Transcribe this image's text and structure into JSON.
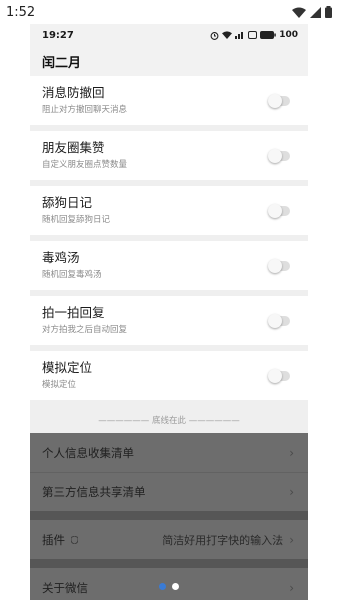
{
  "system_bar": {
    "time": "1:52"
  },
  "inner_status": {
    "time": "19:27",
    "battery": "100"
  },
  "header": {
    "title": "闰二月"
  },
  "settings": [
    {
      "title": "消息防撤回",
      "desc": "阻止对方撤回聊天消息"
    },
    {
      "title": "朋友圈集赞",
      "desc": "自定义朋友圈点赞数量"
    },
    {
      "title": "舔狗日记",
      "desc": "随机回复舔狗日记"
    },
    {
      "title": "毒鸡汤",
      "desc": "随机回复毒鸡汤"
    },
    {
      "title": "拍一拍回复",
      "desc": "对方拍我之后自动回复"
    },
    {
      "title": "模拟定位",
      "desc": "模拟定位"
    }
  ],
  "bottom_line": "—————— 底线在此 ——————",
  "menu": {
    "privacy_list": "个人信息收集清单",
    "third_party_list": "第三方信息共享清单",
    "plugin_label": "插件",
    "plugin_value": "简洁好用打字快的输入法",
    "about": "关于微信"
  },
  "colors": {
    "pager_active": "#3a7bd5",
    "pager_inactive": "#ffffff"
  }
}
